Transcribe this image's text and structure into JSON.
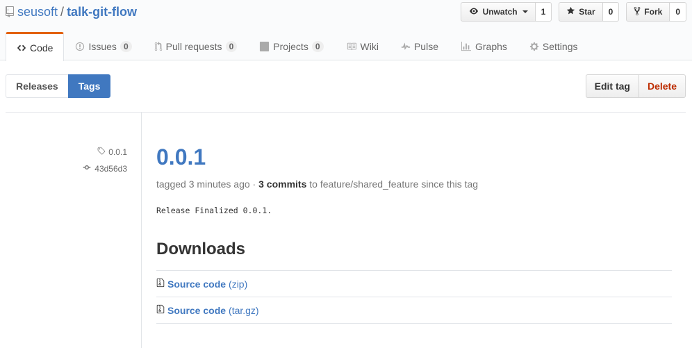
{
  "repo": {
    "owner": "seusoft",
    "separator": "/",
    "name": "talk-git-flow"
  },
  "social": {
    "watch": {
      "label": "Unwatch",
      "count": "1"
    },
    "star": {
      "label": "Star",
      "count": "0"
    },
    "fork": {
      "label": "Fork",
      "count": "0"
    }
  },
  "tabs": [
    {
      "label": "Code",
      "icon": "code-icon"
    },
    {
      "label": "Issues",
      "icon": "issue-icon",
      "count": "0"
    },
    {
      "label": "Pull requests",
      "icon": "pull-request-icon",
      "count": "0"
    },
    {
      "label": "Projects",
      "icon": "project-icon",
      "count": "0"
    },
    {
      "label": "Wiki",
      "icon": "book-icon"
    },
    {
      "label": "Pulse",
      "icon": "pulse-icon"
    },
    {
      "label": "Graphs",
      "icon": "graph-icon"
    },
    {
      "label": "Settings",
      "icon": "gear-icon"
    }
  ],
  "subnav": {
    "releases": "Releases",
    "tags": "Tags"
  },
  "tag_actions": {
    "edit": "Edit tag",
    "delete": "Delete"
  },
  "release": {
    "tag": "0.0.1",
    "commit": "43d56d3",
    "title": "0.0.1",
    "meta_prefix": "tagged 3 minutes ago · ",
    "commits": "3 commits",
    "meta_suffix": " to feature/shared_feature since this tag",
    "note": "Release Finalized 0.0.1."
  },
  "downloads": {
    "heading": "Downloads",
    "items": [
      {
        "label": "Source code",
        "format": "(zip)"
      },
      {
        "label": "Source code",
        "format": "(tar.gz)"
      }
    ]
  },
  "colors": {
    "accent": "#4078c0",
    "tab_highlight": "#e36209",
    "danger": "#bd2c00"
  }
}
